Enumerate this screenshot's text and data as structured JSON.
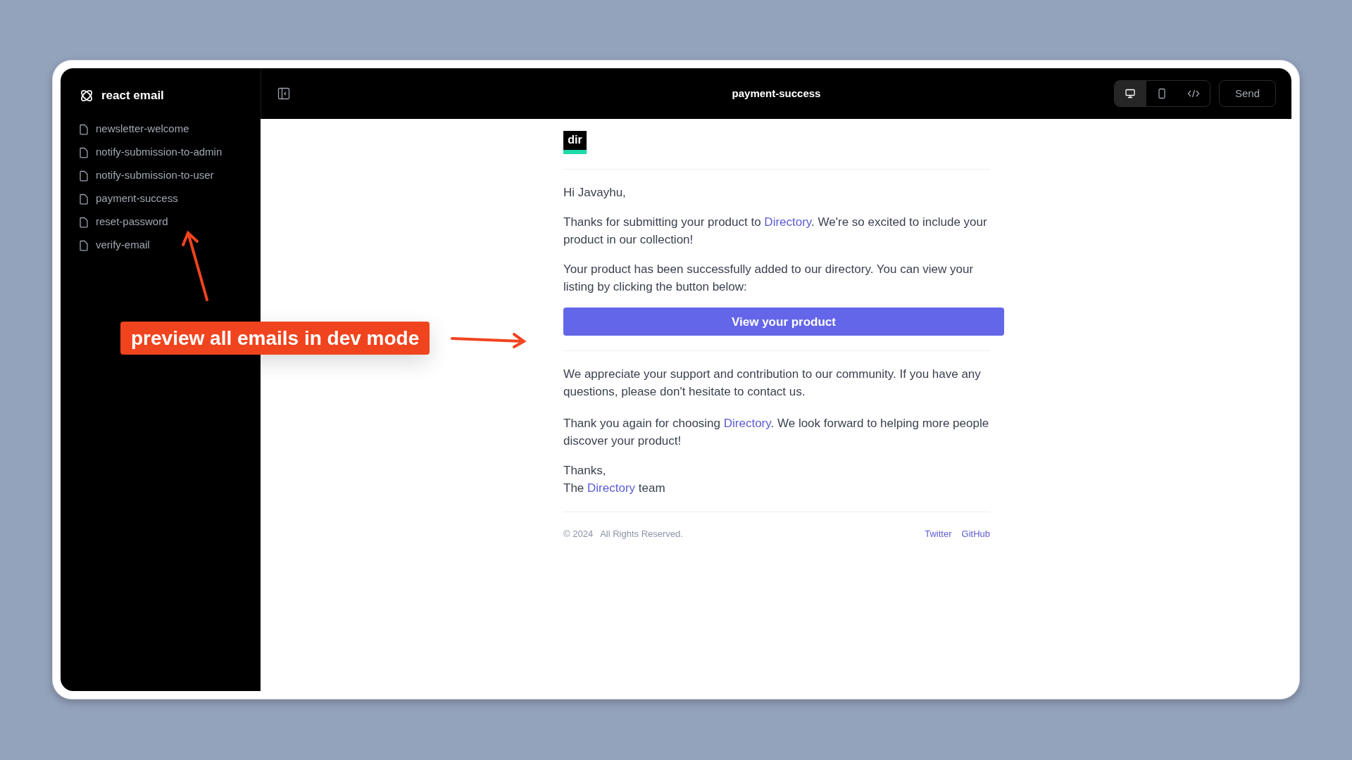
{
  "sidebar": {
    "brand": "react email",
    "items": [
      {
        "label": "newsletter-welcome"
      },
      {
        "label": "notify-submission-to-admin"
      },
      {
        "label": "notify-submission-to-user"
      },
      {
        "label": "payment-success"
      },
      {
        "label": "reset-password"
      },
      {
        "label": "verify-email"
      }
    ]
  },
  "toolbar": {
    "title": "payment-success",
    "views": [
      {
        "kind": "desktop",
        "selected": true
      },
      {
        "kind": "mobile",
        "selected": false
      },
      {
        "kind": "code",
        "selected": false
      }
    ],
    "send": "Send"
  },
  "email": {
    "logo": "dir",
    "greeting": "Hi Javayhu,",
    "paragraphs": [
      {
        "segments": [
          {
            "text": "Thanks for submitting your product to "
          },
          {
            "text": "Directory",
            "link": true
          },
          {
            "text": ". We're so excited to include your product in our collection!"
          }
        ]
      },
      {
        "segments": [
          {
            "text": "Your product has been successfully added to our directory. You can view your listing by clicking the button below:"
          }
        ]
      }
    ],
    "button": "View your product",
    "paragraphs_after": [
      {
        "segments": [
          {
            "text": "We appreciate your support and contribution to our community. If you have any questions, please don't hesitate to contact us."
          }
        ]
      },
      {
        "segments": [
          {
            "text": "Thank you again for choosing "
          },
          {
            "text": "Directory",
            "link": true
          },
          {
            "text": ". We look forward to helping more people discover your product!"
          }
        ]
      }
    ],
    "sign_off": [
      {
        "segments": [
          {
            "text": "Thanks,"
          }
        ]
      },
      {
        "segments": [
          {
            "text": "The "
          },
          {
            "text": "Directory",
            "link": true
          },
          {
            "text": " team"
          }
        ]
      }
    ],
    "footer": {
      "copyright": "© 2024",
      "rights": "All Rights Reserved.",
      "links": [
        "Twitter",
        "GitHub"
      ]
    }
  },
  "annotation": {
    "label": "preview all emails in dev mode"
  }
}
